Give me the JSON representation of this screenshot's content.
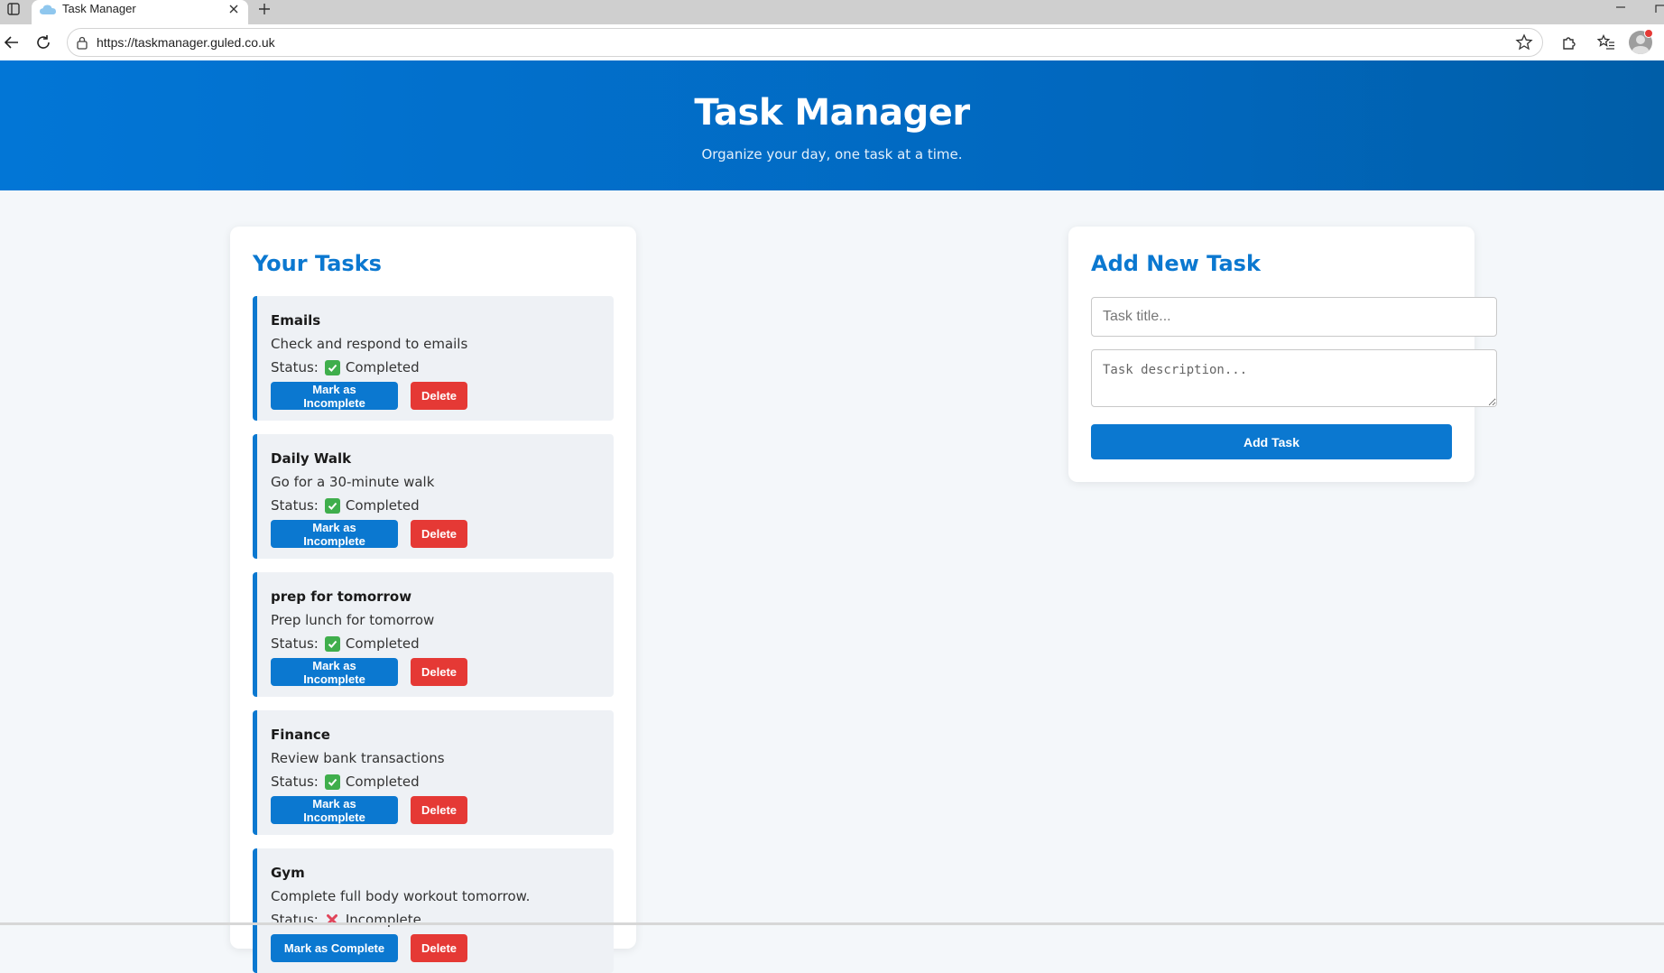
{
  "browser": {
    "tab_title": "Task Manager",
    "url": "https://taskmanager.guled.co.uk"
  },
  "header": {
    "title": "Task Manager",
    "subtitle": "Organize your day, one task at a time."
  },
  "tasks_panel": {
    "heading": "Your Tasks",
    "status_label": "Status:",
    "delete_label": "Delete",
    "tasks": [
      {
        "title": "Emails",
        "description": "Check and respond to emails",
        "status": "Completed",
        "status_icon": "check-icon",
        "toggle_label": "Mark as Incomplete"
      },
      {
        "title": "Daily Walk",
        "description": "Go for a 30-minute walk",
        "status": "Completed",
        "status_icon": "check-icon",
        "toggle_label": "Mark as Incomplete"
      },
      {
        "title": "prep for tomorrow",
        "description": "Prep lunch for tomorrow",
        "status": "Completed",
        "status_icon": "check-icon",
        "toggle_label": "Mark as Incomplete"
      },
      {
        "title": "Finance",
        "description": "Review bank transactions",
        "status": "Completed",
        "status_icon": "check-icon",
        "toggle_label": "Mark as Incomplete"
      },
      {
        "title": "Gym",
        "description": "Complete full body workout tomorrow.",
        "status": "Incomplete",
        "status_icon": "cross-icon",
        "toggle_label": "Mark as Complete"
      }
    ]
  },
  "add_panel": {
    "heading": "Add New Task",
    "title_placeholder": "Task title...",
    "title_value": "",
    "description_placeholder": "Task description...",
    "description_value": "",
    "button_label": "Add Task"
  },
  "colors": {
    "accent": "#0b78d0",
    "danger": "#e53935",
    "success": "#3fae4c",
    "page_bg": "#f4f7fa"
  }
}
